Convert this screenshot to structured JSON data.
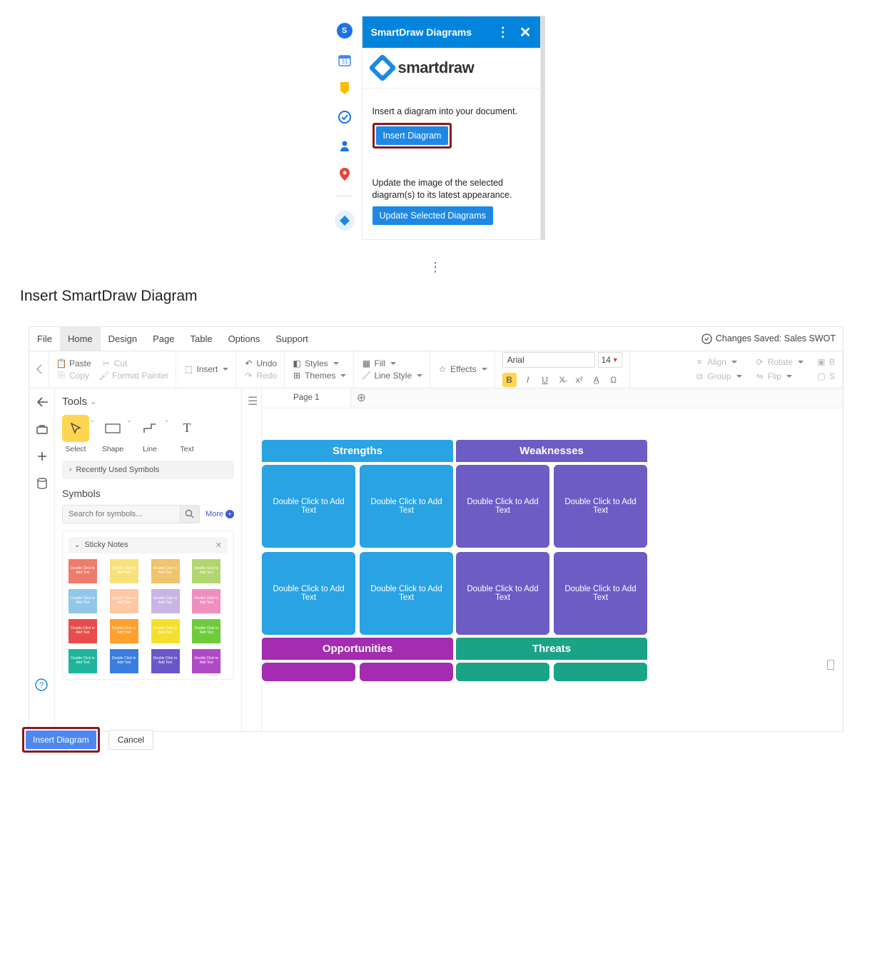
{
  "addon": {
    "avatar": "S",
    "title": "SmartDraw Diagrams",
    "logo_text": "smartdraw",
    "insert_text": "Insert a diagram into your document.",
    "insert_btn": "Insert Diagram",
    "update_text": "Update the image of the selected diagram(s) to its latest appearance.",
    "update_btn": "Update Selected Diagrams"
  },
  "heading": "Insert SmartDraw Diagram",
  "menubar": {
    "tabs": [
      "File",
      "Home",
      "Design",
      "Page",
      "Table",
      "Options",
      "Support"
    ],
    "active": "Home",
    "saved_label": "Changes Saved: Sales SWOT"
  },
  "ribbon": {
    "paste": "Paste",
    "cut": "Cut",
    "copy": "Copy",
    "fmtpainter": "Format Painter",
    "insert": "Insert",
    "undo": "Undo",
    "redo": "Redo",
    "styles": "Styles",
    "themes": "Themes",
    "fill": "Fill",
    "linestyle": "Line Style",
    "effects": "Effects",
    "font": "Arial",
    "fontsize": "14",
    "align": "Align",
    "group": "Group",
    "rotate": "Rotate",
    "flip": "Flip"
  },
  "tools": {
    "title": "Tools",
    "select": "Select",
    "shape": "Shape",
    "line": "Line",
    "text": "Text",
    "recent": "Recently Used Symbols",
    "symbols_title": "Symbols",
    "search_placeholder": "Search for symbols...",
    "more": "More",
    "sticky_title": "Sticky Notes",
    "note_label": "Double Click to Add Text",
    "note_colors": [
      "#ef7b6b",
      "#f7e27a",
      "#f0c36d",
      "#b2d66f",
      "#8fc7e8",
      "#ffc8a2",
      "#c9b4e4",
      "#ef8fbf",
      "#e84c4c",
      "#ff9f2e",
      "#f4e02c",
      "#6ecb3c",
      "#1eb59c",
      "#3a7de0",
      "#6b57c8",
      "#b049c5"
    ]
  },
  "pages": {
    "page1": "Page 1"
  },
  "swot": {
    "strengths": "Strengths",
    "weaknesses": "Weaknesses",
    "opportunities": "Opportunities",
    "threats": "Threats",
    "cell": "Double Click to Add Text"
  },
  "footer": {
    "insert": "Insert Diagram",
    "cancel": "Cancel"
  }
}
